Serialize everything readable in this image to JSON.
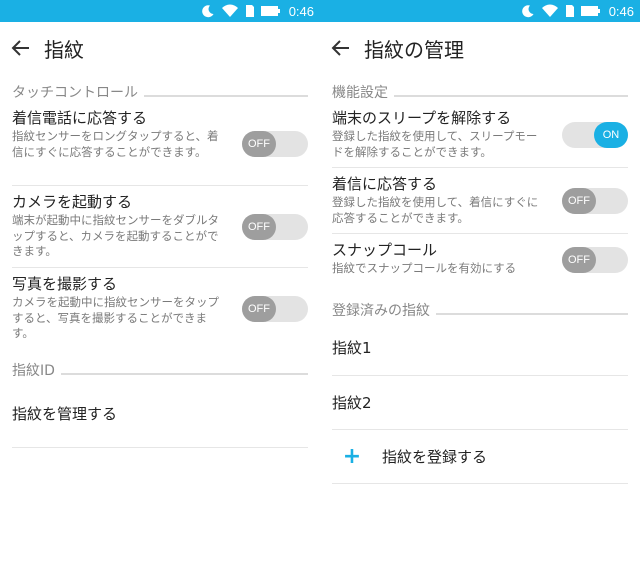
{
  "status": {
    "time": "0:46"
  },
  "left": {
    "title": "指紋",
    "section1": "タッチコントロール",
    "items": [
      {
        "title": "着信電話に応答する",
        "desc": "指紋センサーをロングタップすると、着信にすぐに応答することができます。",
        "state": "OFF"
      },
      {
        "title": "カメラを起動する",
        "desc": "端末が起動中に指紋センサーをダブルタップすると、カメラを起動することができます。",
        "state": "OFF"
      },
      {
        "title": "写真を撮影する",
        "desc": "カメラを起動中に指紋センサーをタップすると、写真を撮影することができます。",
        "state": "OFF"
      }
    ],
    "section2": "指紋ID",
    "manage": "指紋を管理する"
  },
  "right": {
    "title": "指紋の管理",
    "section1": "機能設定",
    "items": [
      {
        "title": "端末のスリープを解除する",
        "desc": "登録した指紋を使用して、スリープモードを解除することができます。",
        "state": "ON"
      },
      {
        "title": "着信に応答する",
        "desc": "登録した指紋を使用して、着信にすぐに応答することができます。",
        "state": "OFF"
      },
      {
        "title": "スナップコール",
        "desc": "指紋でスナップコールを有効にする",
        "state": "OFF"
      }
    ],
    "section2": "登録済みの指紋",
    "fingerprints": [
      "指紋1",
      "指紋2"
    ],
    "add_label": "指紋を登録する",
    "add_symbol": "+"
  },
  "colors": {
    "accent": "#1ab0e4",
    "toggle_off": "#9e9e9e"
  }
}
